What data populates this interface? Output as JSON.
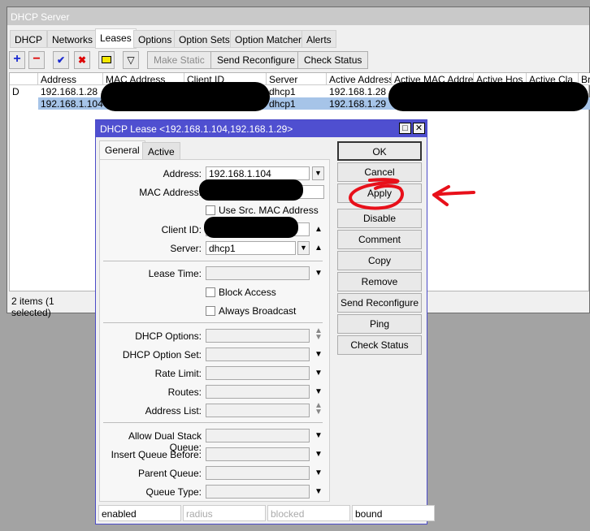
{
  "window": {
    "title": "DHCP Server",
    "tabs": [
      "DHCP",
      "Networks",
      "Leases",
      "Options",
      "Option Sets",
      "Option Matcher",
      "Alerts"
    ],
    "selected_tab": "Leases",
    "toolbar": {
      "make_static": "Make Static",
      "send_reconfigure": "Send Reconfigure",
      "check_status": "Check Status"
    },
    "columns": [
      "",
      "Address",
      "MAC Address",
      "Client ID",
      "Server",
      "Active Address",
      "Active MAC Addre",
      "Active Hos",
      "Active Cla",
      "Brid"
    ],
    "rows": [
      {
        "flag": "D",
        "address": "192.168.1.28",
        "server": "dhcp1",
        "active_address": "192.168.1.28"
      },
      {
        "flag": "",
        "address": "192.168.1.104",
        "server": "dhcp1",
        "active_address": "192.168.1.29"
      }
    ],
    "status": "2 items (1 selected)"
  },
  "dialog": {
    "title": "DHCP Lease <192.168.1.104,192.168.1.29>",
    "tabs": [
      "General",
      "Active"
    ],
    "labels": {
      "address": "Address:",
      "mac": "MAC Address:",
      "use_src_mac": "Use Src. MAC Address",
      "client_id": "Client ID:",
      "server": "Server:",
      "lease_time": "Lease Time:",
      "block_access": "Block Access",
      "always_broadcast": "Always Broadcast",
      "dhcp_options": "DHCP Options:",
      "dhcp_option_set": "DHCP Option Set:",
      "rate_limit": "Rate Limit:",
      "routes": "Routes:",
      "address_list": "Address List:",
      "allow_dual": "Allow Dual Stack Queue:",
      "insert_queue": "Insert Queue Before:",
      "parent_queue": "Parent Queue:",
      "queue_type": "Queue Type:"
    },
    "values": {
      "address": "192.168.1.104",
      "server": "dhcp1"
    },
    "buttons": [
      "OK",
      "Cancel",
      "Apply",
      "Disable",
      "Comment",
      "Copy",
      "Remove",
      "Send Reconfigure",
      "Ping",
      "Check Status"
    ],
    "status": [
      "enabled",
      "radius",
      "blocked",
      "bound"
    ]
  },
  "colors": {
    "title_blue": "#4f4fd0",
    "selected_row": "#a6c4e8",
    "annotation_red": "#e8101a"
  }
}
